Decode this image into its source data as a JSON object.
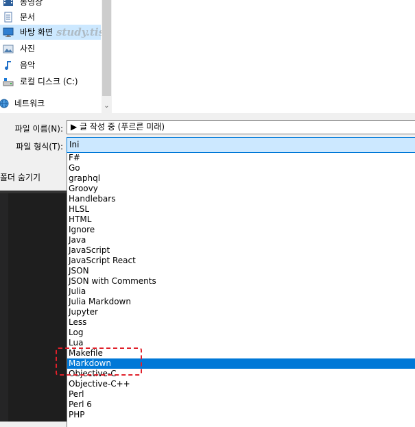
{
  "nav": {
    "items": [
      {
        "label": "동영상",
        "icon": "video-folder-icon"
      },
      {
        "label": "문서",
        "icon": "documents-folder-icon"
      },
      {
        "label": "바탕 화면",
        "icon": "desktop-folder-icon",
        "selected": true
      },
      {
        "label": "사진",
        "icon": "pictures-folder-icon"
      },
      {
        "label": "음악",
        "icon": "music-folder-icon"
      },
      {
        "label": "로컬 디스크 (C:)",
        "icon": "local-disk-icon"
      },
      {
        "label": "네트워크",
        "icon": "network-icon"
      }
    ],
    "watermark": "study.tistory.com”"
  },
  "form": {
    "filename_label": "파일 이름(N):",
    "filename_value": "▶ 글 작성 중 (푸르른 미래)",
    "filetype_label": "파일 형식(T):",
    "filetype_value": "Ini",
    "hide_folders_label": "폴더 숨기기"
  },
  "dropdown": {
    "selected_index": 20,
    "items": [
      "F#",
      "Go",
      "graphql",
      "Groovy",
      "Handlebars",
      "HLSL",
      "HTML",
      "Ignore",
      "Java",
      "JavaScript",
      "JavaScript React",
      "JSON",
      "JSON with Comments",
      "Julia",
      "Julia Markdown",
      "Jupyter",
      "Less",
      "Log",
      "Lua",
      "Makefile",
      "Markdown",
      "Objective-C",
      "Objective-C++",
      "Perl",
      "Perl 6",
      "PHP"
    ]
  },
  "colors": {
    "selection": "#0078d7",
    "selection_light": "#cce8ff",
    "annotation": "#e0202a"
  }
}
